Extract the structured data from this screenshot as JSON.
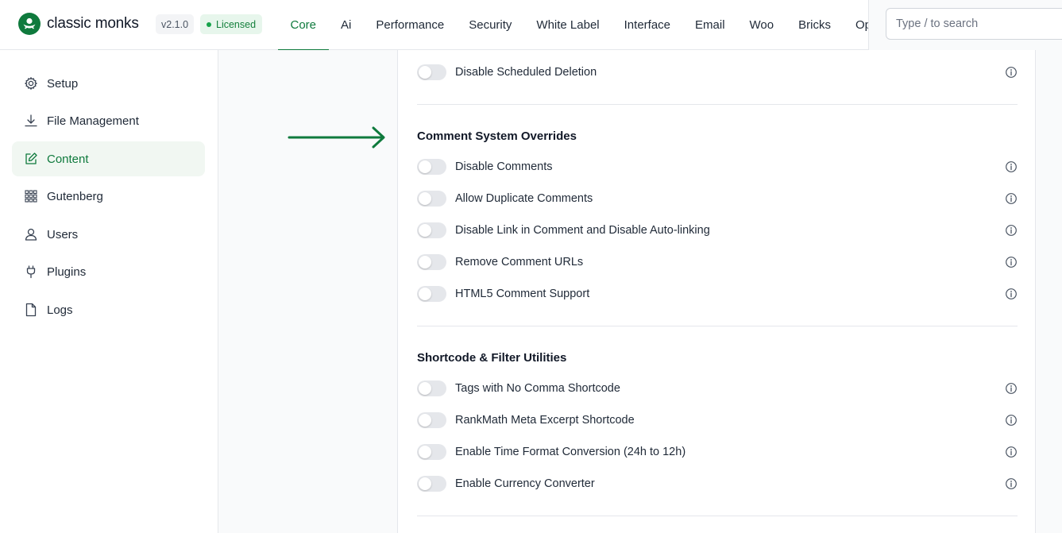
{
  "header": {
    "logo_text": "classic monks",
    "version": "v2.1.0",
    "license_status": "Licensed",
    "nav": [
      {
        "label": "Core",
        "active": true
      },
      {
        "label": "Ai"
      },
      {
        "label": "Performance"
      },
      {
        "label": "Security"
      },
      {
        "label": "White Label"
      },
      {
        "label": "Interface"
      },
      {
        "label": "Email"
      },
      {
        "label": "Woo"
      },
      {
        "label": "Bricks"
      },
      {
        "label": "Opt"
      }
    ],
    "search_placeholder": "Type / to search"
  },
  "sidebar": {
    "items": [
      {
        "label": "Setup",
        "icon": "gear-icon"
      },
      {
        "label": "File Management",
        "icon": "download-icon"
      },
      {
        "label": "Content",
        "icon": "edit-icon",
        "active": true
      },
      {
        "label": "Gutenberg",
        "icon": "grid-icon"
      },
      {
        "label": "Users",
        "icon": "user-icon"
      },
      {
        "label": "Plugins",
        "icon": "plug-icon"
      },
      {
        "label": "Logs",
        "icon": "file-icon"
      }
    ]
  },
  "content": {
    "top_setting": {
      "label": "Disable Scheduled Deletion",
      "enabled": false
    },
    "sections": [
      {
        "title": "Comment System Overrides",
        "settings": [
          {
            "label": "Disable Comments",
            "enabled": false
          },
          {
            "label": "Allow Duplicate Comments",
            "enabled": false
          },
          {
            "label": "Disable Link in Comment and Disable Auto-linking",
            "enabled": false
          },
          {
            "label": "Remove Comment URLs",
            "enabled": false
          },
          {
            "label": "HTML5 Comment Support",
            "enabled": false
          }
        ]
      },
      {
        "title": "Shortcode & Filter Utilities",
        "settings": [
          {
            "label": "Tags with No Comma Shortcode",
            "enabled": false
          },
          {
            "label": "RankMath Meta Excerpt Shortcode",
            "enabled": false
          },
          {
            "label": "Enable Time Format Conversion (24h to 12h)",
            "enabled": false
          },
          {
            "label": "Enable Currency Converter",
            "enabled": false
          }
        ]
      }
    ]
  },
  "colors": {
    "brand": "#0f7a3d",
    "toggle_off": "#e5e7eb",
    "active_bg": "#f1f7f2"
  }
}
